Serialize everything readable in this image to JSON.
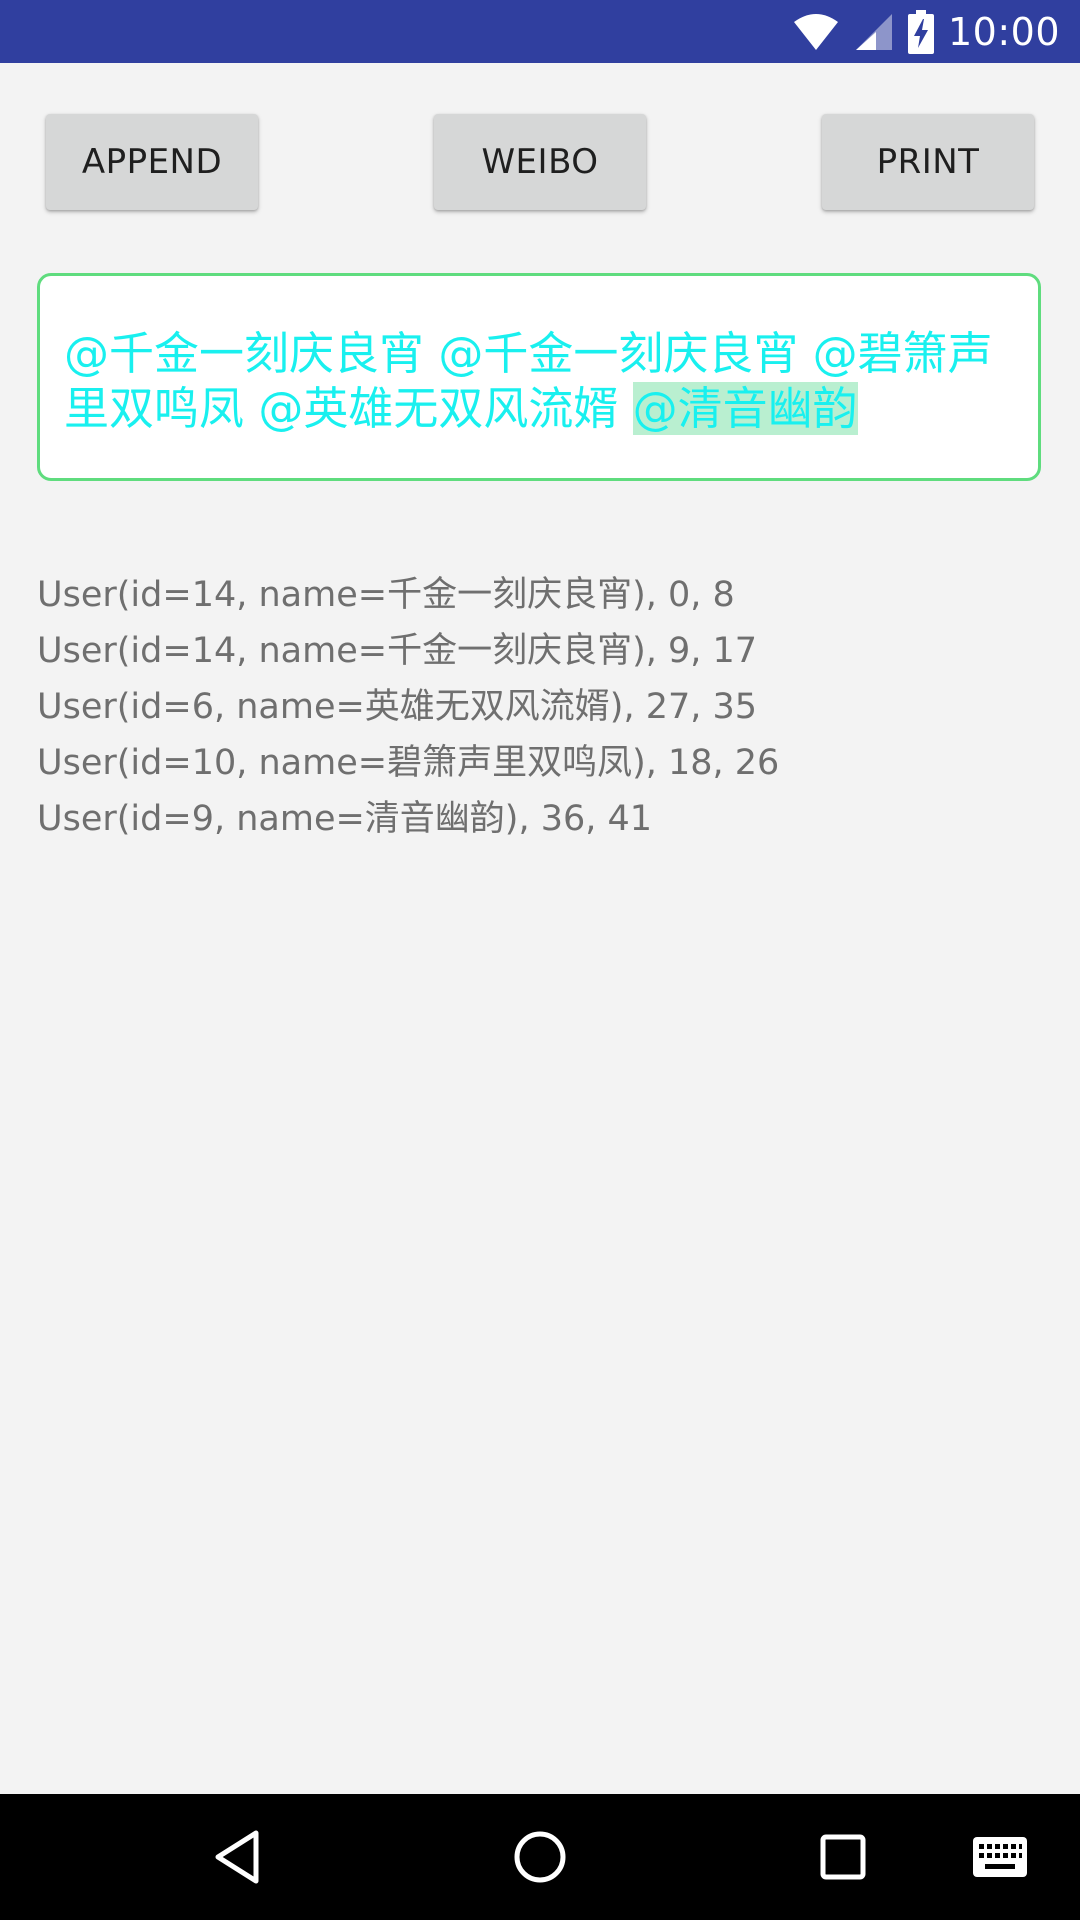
{
  "status_bar": {
    "time": "10:00",
    "background": "#303f9f",
    "icons": [
      "wifi-icon",
      "signal-icon",
      "battery-charging-icon"
    ]
  },
  "toolbar": {
    "append_label": "APPEND",
    "weibo_label": "WEIBO",
    "print_label": "PRINT"
  },
  "editor": {
    "border_color": "#5fdc7e",
    "text_color": "#19f0ef",
    "mentions": [
      "@千金一刻庆良宵",
      "@千金一刻庆良宵",
      "@碧箫声里双鸣凤",
      "@英雄无双风流婿",
      "@清音幽韵"
    ],
    "separator": " ",
    "selected_index": 4
  },
  "log": {
    "lines": [
      "User(id=14, name=千金一刻庆良宵), 0, 8",
      "User(id=14, name=千金一刻庆良宵), 9, 17",
      "User(id=6, name=英雄无双风流婿), 27, 35",
      "User(id=10, name=碧箫声里双鸣凤), 18, 26",
      "User(id=9, name=清音幽韵), 36, 41"
    ]
  },
  "nav_bar": {
    "icons": [
      "back-icon",
      "home-icon",
      "recents-icon",
      "keyboard-icon"
    ]
  }
}
